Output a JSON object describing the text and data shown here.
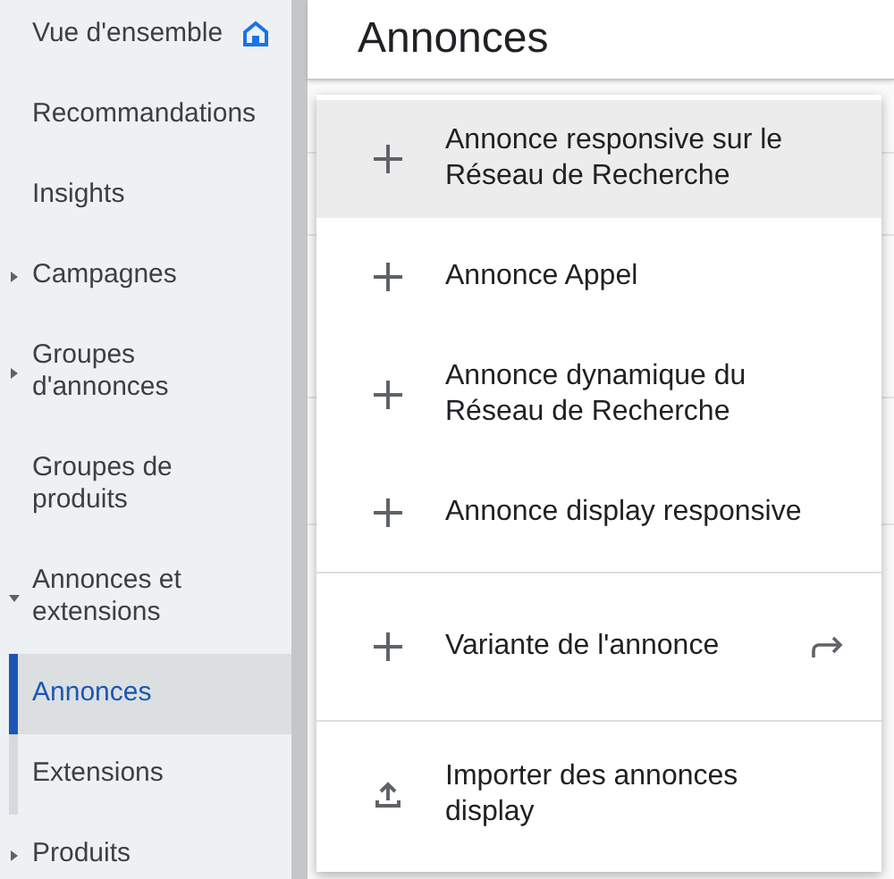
{
  "sidebar": {
    "items": [
      {
        "label": "Vue d'ensemble",
        "kind": "home",
        "selected": false
      },
      {
        "label": "Recommandations",
        "kind": "link",
        "selected": false
      },
      {
        "label": "Insights",
        "kind": "link",
        "selected": false
      },
      {
        "label": "Campagnes",
        "kind": "group",
        "expanded": false,
        "selected": false
      },
      {
        "label": "Groupes d'annonces",
        "kind": "group",
        "expanded": false,
        "selected": false
      },
      {
        "label": "Groupes de produits",
        "kind": "link",
        "selected": false
      },
      {
        "label": "Annonces et extensions",
        "kind": "group",
        "expanded": true,
        "selected": false,
        "children": [
          {
            "label": "Annonces",
            "selected": true
          },
          {
            "label": "Extensions",
            "selected": false
          }
        ]
      },
      {
        "label": "Produits",
        "kind": "group",
        "expanded": false,
        "selected": false
      }
    ]
  },
  "page": {
    "title": "Annonces"
  },
  "menu": {
    "sections": [
      {
        "items": [
          {
            "label": "Annonce responsive sur le Réseau de Recherche",
            "kind": "add",
            "highlighted": true,
            "submenu": false
          },
          {
            "label": "Annonce Appel",
            "kind": "add",
            "highlighted": false,
            "submenu": false
          },
          {
            "label": "Annonce dynamique du Réseau de Recherche",
            "kind": "add",
            "highlighted": false,
            "submenu": false
          },
          {
            "label": "Annonce display responsive",
            "kind": "add",
            "highlighted": false,
            "submenu": false
          }
        ]
      },
      {
        "items": [
          {
            "label": "Variante de l'annonce",
            "kind": "add",
            "highlighted": false,
            "submenu": true
          }
        ]
      },
      {
        "items": [
          {
            "label": "Importer des annonces display",
            "kind": "upload",
            "highlighted": false,
            "submenu": false
          }
        ]
      }
    ]
  }
}
